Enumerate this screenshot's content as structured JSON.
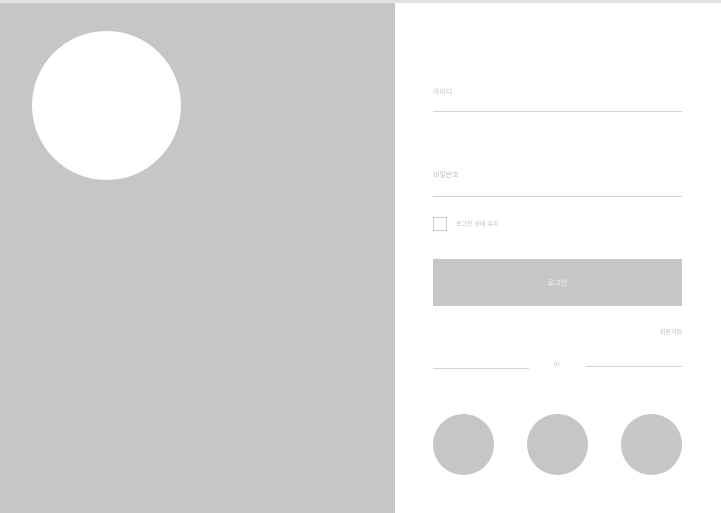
{
  "login_form": {
    "id_label": "아이디",
    "password_label": "비밀번호",
    "keep_logged_in_label": "로그인 상태 유지",
    "login_button_label": "로그인",
    "signup_link_label": "회원가입",
    "divider_label": "or"
  },
  "colors": {
    "panel_gray": "#c6c6c6",
    "text_gray": "#bdbdbd",
    "line_gray": "#d3d3d3",
    "background": "#ffffff"
  }
}
